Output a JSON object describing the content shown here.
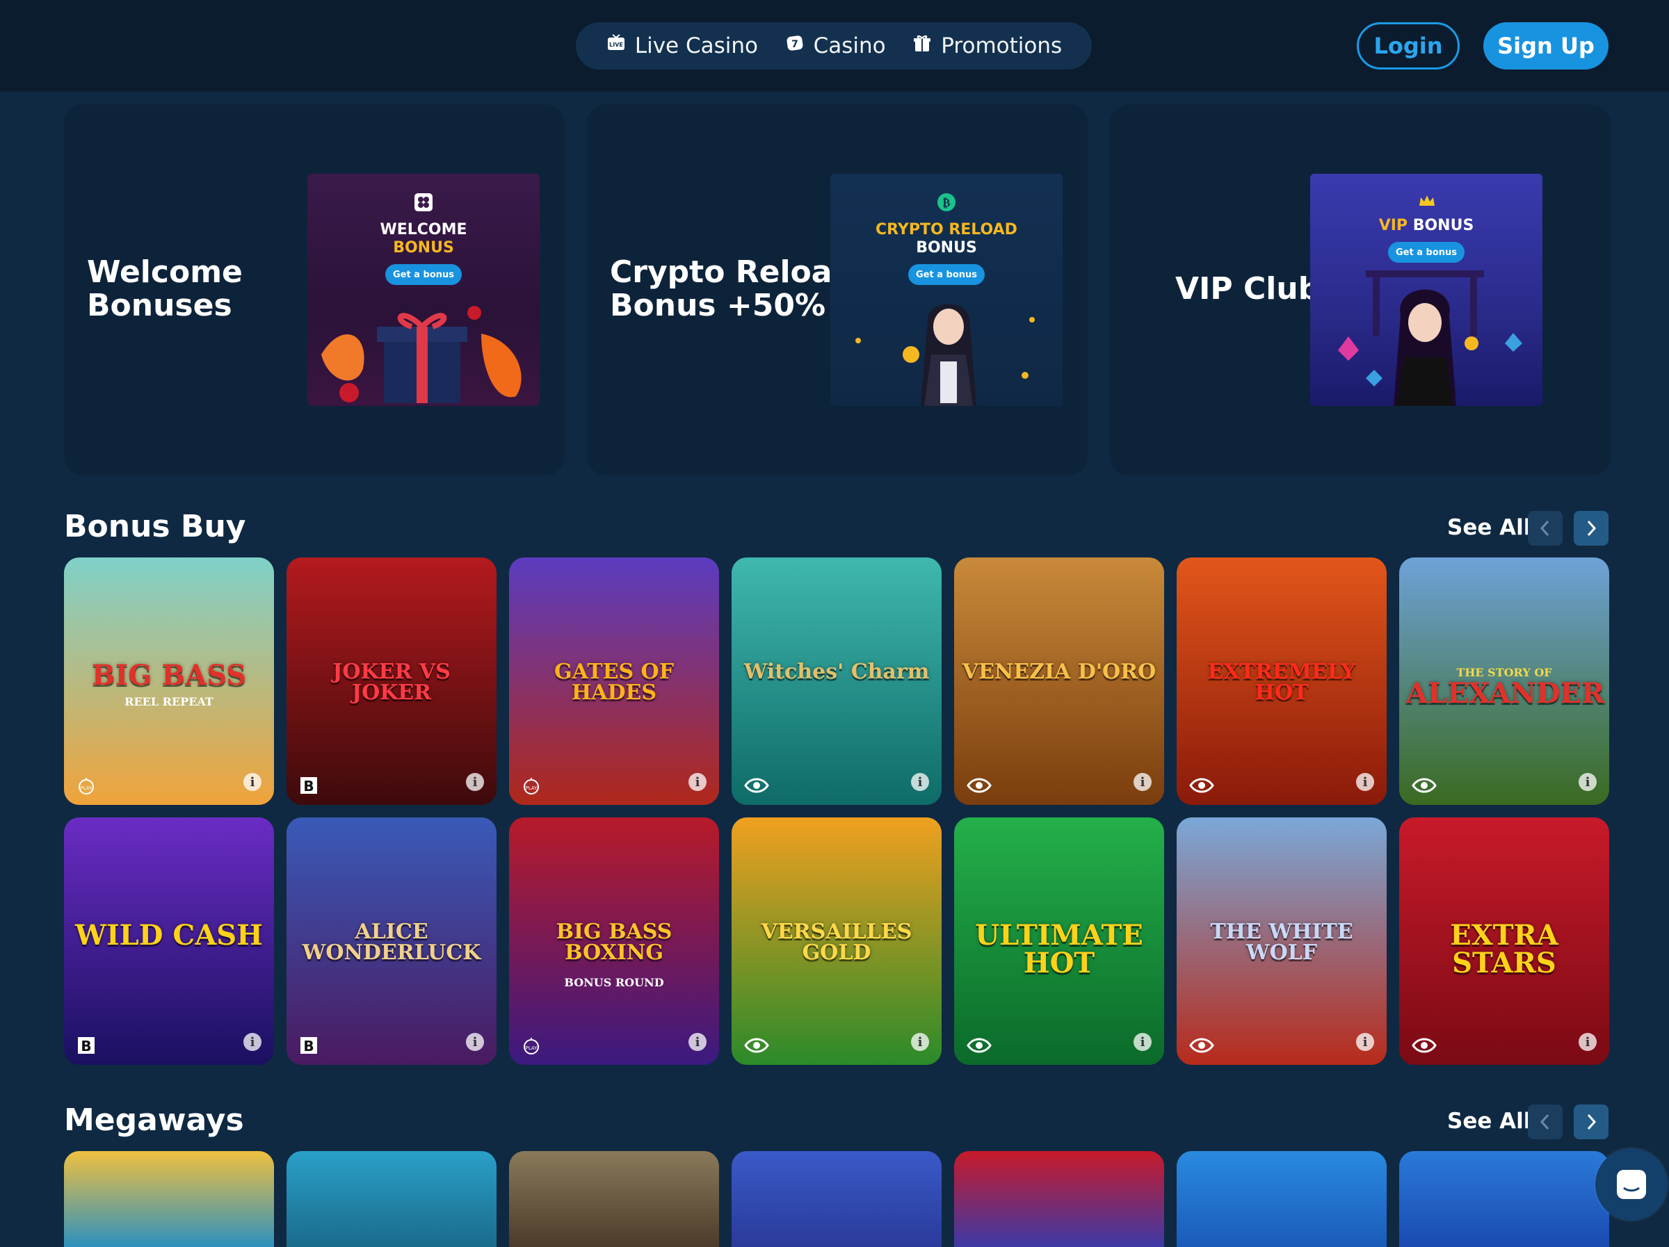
{
  "nav": {
    "items": [
      {
        "label": "Live Casino",
        "icon": "live-tv-icon"
      },
      {
        "label": "Casino",
        "icon": "dice-icon"
      },
      {
        "label": "Promotions",
        "icon": "gift-icon"
      }
    ],
    "login": "Login",
    "signup": "Sign Up"
  },
  "promos": [
    {
      "title": "Welcome\nBonuses",
      "img_title_1": "WELCOME",
      "img_title_2": "BONUS",
      "img_btn": "Get a bonus"
    },
    {
      "title": "Crypto Reload\nBonus +50%",
      "img_title_1": "CRYPTO RELOAD",
      "img_title_2": "BONUS",
      "img_btn": "Get a bonus"
    },
    {
      "title": "VIP Club",
      "img_title_1": "VIP",
      "img_title_2": "BONUS",
      "img_btn": "Get a bonus"
    }
  ],
  "sections": {
    "bonus_buy": {
      "title": "Bonus Buy",
      "see_all": "See All"
    },
    "megaways": {
      "title": "Megaways",
      "see_all": "See All"
    }
  },
  "bonus_buy_games": [
    {
      "logo": "BIG BASS",
      "sub": "REEL REPEAT",
      "provider": "pragmatic-icon",
      "colors": [
        "#7fd1c9",
        "#f0a33a"
      ],
      "logo_color": "#e0312a"
    },
    {
      "logo": "JOKER VS JOKER",
      "sub": "",
      "provider": "bgaming-icon",
      "colors": [
        "#b41a1e",
        "#3d0a0c"
      ],
      "logo_color": "#ff3b45"
    },
    {
      "logo": "GATES OF HADES",
      "sub": "",
      "provider": "pragmatic-icon",
      "colors": [
        "#5b3cc0",
        "#b0281a"
      ],
      "logo_color": "#ffb21a"
    },
    {
      "logo": "Witches' Charm",
      "sub": "",
      "provider": "eye-icon",
      "colors": [
        "#3fb8ae",
        "#0f6b67"
      ],
      "logo_color": "#e2c06a"
    },
    {
      "logo": "VENEZIA D'ORO",
      "sub": "",
      "provider": "eye-icon",
      "colors": [
        "#c98a3a",
        "#7a3d0d"
      ],
      "logo_color": "#f7c04a"
    },
    {
      "logo": "EXTREMELY HOT",
      "sub": "",
      "provider": "eye-icon",
      "colors": [
        "#e2561a",
        "#8a1a0a"
      ],
      "logo_color": "#ff2a1a"
    },
    {
      "logo": "ALEXANDER",
      "sub": "THE STORY OF",
      "provider": "eye-icon",
      "colors": [
        "#6ea2d8",
        "#3a6a20"
      ],
      "logo_color": "#e0322a"
    },
    {
      "logo": "WILD CASH",
      "sub": "",
      "provider": "bgaming-icon",
      "colors": [
        "#6a2cc4",
        "#1a1060"
      ],
      "logo_color": "#ffd21a"
    },
    {
      "logo": "ALICE WONDERLUCK",
      "sub": "",
      "provider": "bgaming-icon",
      "colors": [
        "#3a5ab8",
        "#4a1a60"
      ],
      "logo_color": "#f0d08a"
    },
    {
      "logo": "BIG BASS BOXING",
      "sub": "BONUS ROUND",
      "provider": "pragmatic-icon",
      "colors": [
        "#b81a2a",
        "#3a1a80"
      ],
      "logo_color": "#ffc22a"
    },
    {
      "logo": "VERSAILLES GOLD",
      "sub": "",
      "provider": "eye-icon",
      "colors": [
        "#f0a020",
        "#2a8a2a"
      ],
      "logo_color": "#ffd84a"
    },
    {
      "logo": "ULTIMATE HOT",
      "sub": "",
      "provider": "eye-icon",
      "colors": [
        "#24b04a",
        "#0b6a2a"
      ],
      "logo_color": "#ffd21a"
    },
    {
      "logo": "THE WHITE WOLF",
      "sub": "",
      "provider": "eye-icon",
      "colors": [
        "#7aa8d8",
        "#b82a1a"
      ],
      "logo_color": "#c8d8f8"
    },
    {
      "logo": "EXTRA STARS",
      "sub": "",
      "provider": "eye-icon",
      "colors": [
        "#c81a2a",
        "#7a0a14"
      ],
      "logo_color": "#ffd21a"
    }
  ],
  "megaways_games": [
    {
      "colors": [
        "#f0c040",
        "#2a90c0"
      ]
    },
    {
      "colors": [
        "#2aa0c8",
        "#1a6a8a"
      ]
    },
    {
      "colors": [
        "#8a7a5a",
        "#4a3a2a"
      ]
    },
    {
      "colors": [
        "#3a5ac8",
        "#2a3a9a"
      ]
    },
    {
      "colors": [
        "#c81a2a",
        "#3a3aa8"
      ]
    },
    {
      "colors": [
        "#2a8ae0",
        "#1a5ab8"
      ]
    },
    {
      "colors": [
        "#2a7ad8",
        "#1a4ab0"
      ]
    }
  ]
}
